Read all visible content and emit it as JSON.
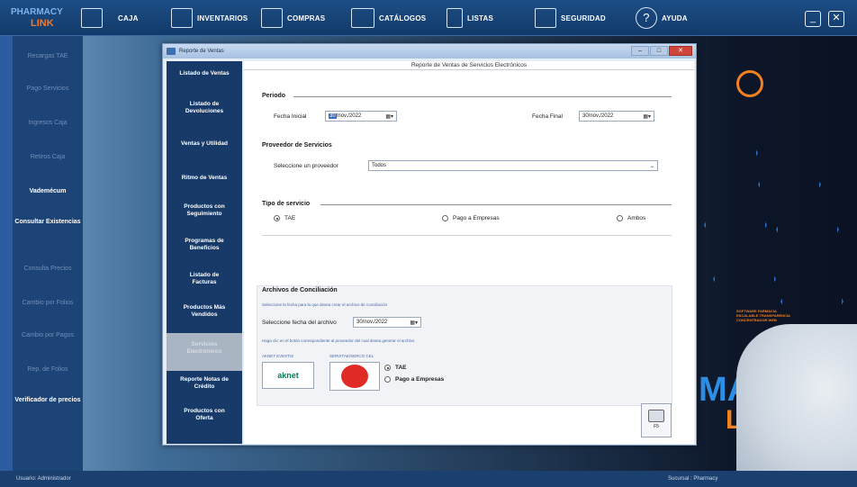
{
  "topbar": {
    "logo_line1": "PHARMACY",
    "logo_line2": "LINK",
    "menu": [
      {
        "label": "CAJA",
        "icon": "cash-register-icon"
      },
      {
        "label": "INVENTARIOS",
        "icon": "inventory-icon"
      },
      {
        "label": "COMPRAS",
        "icon": "purchases-icon"
      },
      {
        "label": "CATÁLOGOS",
        "icon": "folder-icon"
      },
      {
        "label": "LISTAS",
        "icon": "list-icon"
      },
      {
        "label": "SEGURIDAD",
        "icon": "security-icon"
      },
      {
        "label": "AYUDA",
        "icon": "help-icon",
        "glyph": "?"
      }
    ],
    "minimize_glyph": "_",
    "close_glyph": "✕"
  },
  "sidemenu": {
    "items": [
      {
        "label": "Recargas TAE",
        "dim": true
      },
      {
        "label": "Pago Servicios",
        "dim": true
      },
      {
        "label": "Ingresos Caja",
        "dim": true
      },
      {
        "label": "Retiros Caja",
        "dim": true
      },
      {
        "label": "Vademécum",
        "dim": false
      },
      {
        "label": "Consultar Existencias",
        "dim": false
      },
      {
        "label": "Consulta Precios",
        "dim": true
      },
      {
        "label": "Cambio por Folios",
        "dim": true
      },
      {
        "label": "Cambio por Pagos",
        "dim": true
      },
      {
        "label": "Rep. de Folios",
        "dim": true
      },
      {
        "label": "Verificador de precios",
        "dim": false
      }
    ]
  },
  "dialog": {
    "title": "Reporte de Ventas",
    "nav": [
      "Listado de Ventas",
      "Listado de Devoluciones",
      "Ventas y Utilidad",
      "Ritmo de Ventas",
      "Productos con Seguimiento",
      "Programas de Beneficios",
      "Listado de Facturas",
      "Productos Más Vendidos",
      "Servicios Electrónicos",
      "Reporte Notas de Crédito",
      "Productos con Oferta"
    ],
    "active_nav": "Servicios Electrónicos",
    "panel": {
      "title": "Reporte de Ventas de Servicios Electrónicos",
      "periodo": {
        "section": "Periodo",
        "fecha_inicial_label": "Fecha Inicial",
        "fecha_inicial_day": "30",
        "fecha_inicial_rest": "/nov./2022",
        "fecha_final_label": "Fecha Final",
        "fecha_final_value": "30/nov./2022"
      },
      "proveedor": {
        "section": "Proveedor de Servicios",
        "label": "Seleccione un proveedor",
        "value": "Todos"
      },
      "tipo": {
        "section": "Tipo de servicio",
        "options": [
          "TAE",
          "Pago a Empresas",
          "Ambos"
        ],
        "selected": "TAE"
      },
      "conciliacion": {
        "section": "Archivos de Conciliación",
        "hint1": "Seleccione la fecha para la que desea crear el archivo de conciliación",
        "fecha_label": "Seleccione fecha del archivo",
        "fecha_value": "30/nov./2022",
        "hint2": "Haga clic en el botón correspondiente al proveedor del cual desea generar el archivo",
        "vendor1_label": "AKNET EVESTIS",
        "vendor1_logo": "aknet",
        "vendor2_label": "SERVITAE/SERCO CEL",
        "radio_options": [
          "TAE",
          "Pago a Empresas"
        ],
        "radio_selected": "TAE"
      },
      "print_label": "F5"
    }
  },
  "statusbar": {
    "left": "Usuario: Administrador",
    "right": "Sucursal : Pharmacy"
  },
  "background": {
    "brand_line1": "MA",
    "brand_line2": "LI",
    "promo_lines": "SOFTWARE FARMACIA ESCALABLE TRANSPARENCIA CONCENTRADOR WEB"
  }
}
